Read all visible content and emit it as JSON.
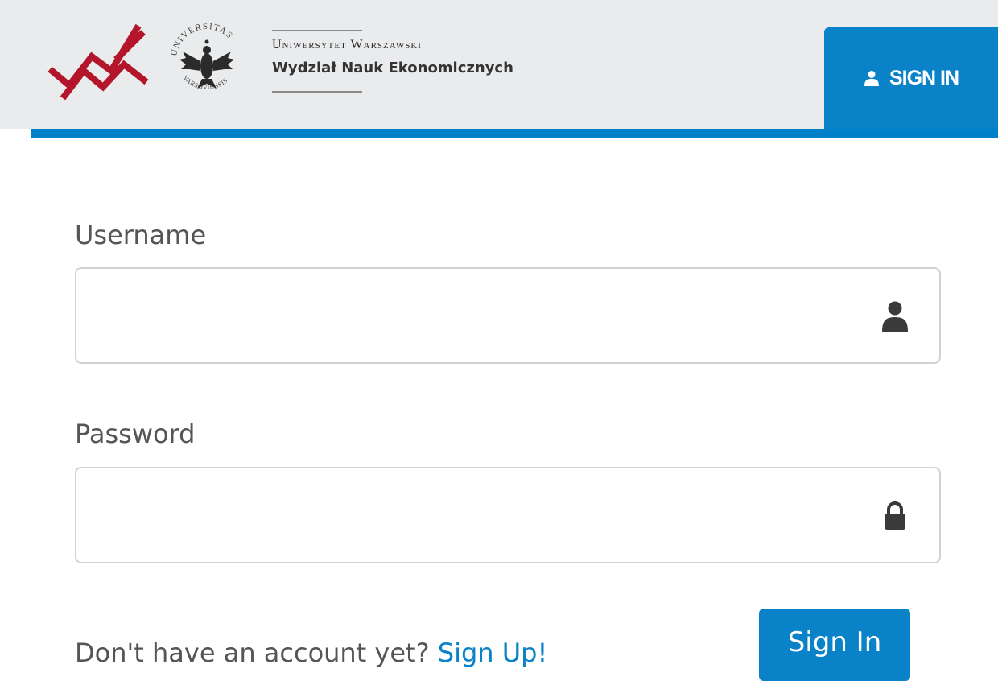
{
  "header": {
    "university_name": "Uniwersytet Warszawski",
    "faculty_name": "Wydział Nauk Ekonomicznych",
    "seal_text_top": "UNIVERSITAS",
    "seal_text_bottom": "VARSOVIENSIS",
    "signin_tab_label": "SIGN IN",
    "signin_tab_icon": "user-icon"
  },
  "form": {
    "username_label": "Username",
    "username_value": "",
    "username_icon": "user-icon",
    "password_label": "Password",
    "password_value": "",
    "password_icon": "lock-icon",
    "signup_prompt": "Don't have an account yet? ",
    "signup_link": "Sign Up!",
    "submit_label": "Sign In"
  },
  "colors": {
    "accent": "#0a82c8",
    "header_background": "#eaebec",
    "logo_red": "#b3162a"
  }
}
